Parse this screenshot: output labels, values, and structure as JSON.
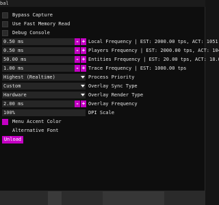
{
  "window": {
    "title": "bal"
  },
  "checks": [
    {
      "label": "Bypass Capture",
      "checked": false
    },
    {
      "label": "Use Fast Memory Read",
      "checked": false
    },
    {
      "label": "Debug Console",
      "checked": false
    }
  ],
  "sliders": [
    {
      "value": "0.50 ms",
      "label": "Local Frequency | EST: 2000.00 tps, ACT: 1051."
    },
    {
      "value": "0.50 ms",
      "label": "Players Frequency | EST: 2000.00 tps, ACT: 104"
    },
    {
      "value": "50.00 ms",
      "label": "Entities Frequency | EST: 20.00 tps, ACT: 18.0"
    },
    {
      "value": "1.00 ms",
      "label": "Trace Frequency | EST: 1000.00 tps"
    }
  ],
  "dropdowns": [
    {
      "value": "Highest (Realtime)",
      "label": "Process Priority"
    },
    {
      "value": "Custom",
      "label": "Overlay Sync Type"
    },
    {
      "value": "Hardware",
      "label": "Overlay Render Type"
    }
  ],
  "overlay_freq": {
    "value": "2.00 ms",
    "label": "Overlay Frequency"
  },
  "dpi": {
    "value": "100%",
    "label": "DPI Scale"
  },
  "accent": {
    "label": "Menu Accent Color",
    "color": "#c400c4"
  },
  "alt_font": {
    "label": "Alternative Font",
    "checked": false
  },
  "unload_label": "Unload",
  "icons": {
    "minus": "-",
    "plus": "+"
  }
}
